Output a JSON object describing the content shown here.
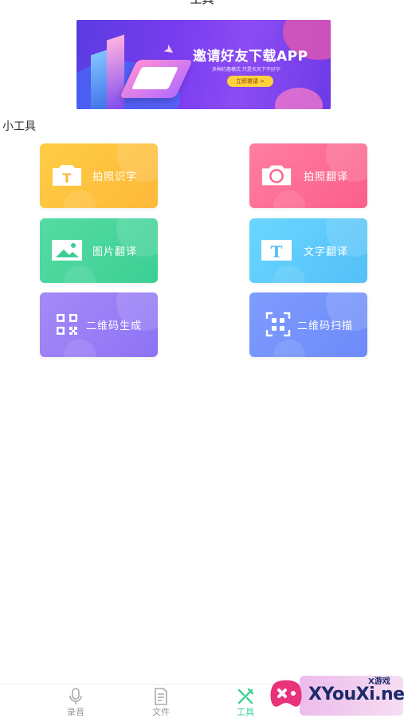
{
  "header": {
    "title": "工具"
  },
  "banner": {
    "headline": "邀请好友下载APP",
    "subtitle": "多种约惠模式  只是天天下不好字",
    "cta_label": "立即邀请 >"
  },
  "section": {
    "title": "小工具"
  },
  "tools": [
    {
      "label": "拍照识字",
      "icon": "text-camera-icon"
    },
    {
      "label": "拍照翻译",
      "icon": "camera-icon"
    },
    {
      "label": "图片翻译",
      "icon": "image-icon"
    },
    {
      "label": "文字翻译",
      "icon": "text-icon"
    },
    {
      "label": "二维码生成",
      "icon": "qr-code-icon"
    },
    {
      "label": "二维码扫描",
      "icon": "qr-scan-icon"
    }
  ],
  "tabbar": {
    "items": [
      {
        "label": "录音",
        "icon": "microphone-icon",
        "active": false
      },
      {
        "label": "文件",
        "icon": "document-icon",
        "active": false
      },
      {
        "label": "工具",
        "icon": "tools-icon",
        "active": true
      }
    ]
  },
  "watermark": {
    "text": "XYouXi.net",
    "small": "X游戏"
  },
  "colors": {
    "active_tab": "#3ccf94",
    "inactive_tab": "#999999"
  }
}
